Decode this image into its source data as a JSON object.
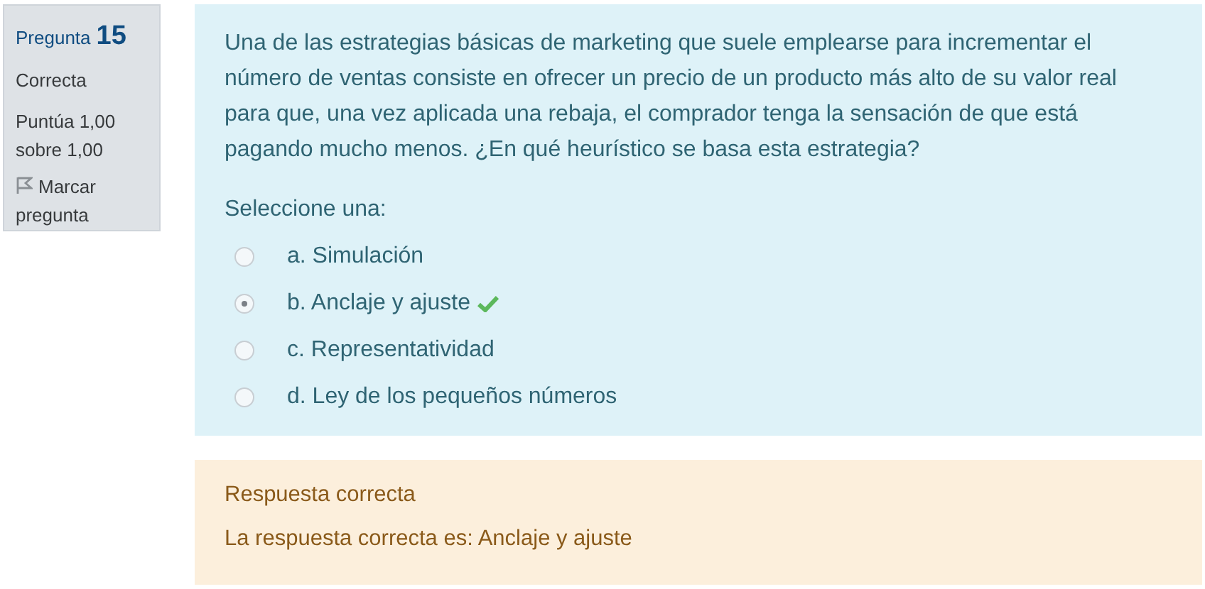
{
  "info": {
    "label": "Pregunta",
    "number": "15",
    "state": "Correcta",
    "grade": "Puntúa 1,00 sobre 1,00",
    "flag": {
      "label": "Marcar pregunta",
      "flagged": false
    }
  },
  "question": {
    "text": "Una de las estrategias básicas de marketing que suele emplearse para incrementar el número de ventas consiste en ofrecer un precio de un producto más alto de su valor real para que, una vez aplicada una rebaja, el comprador tenga la sensación de que está pagando mucho menos. ¿En qué heurístico se basa esta estrategia?",
    "prompt": "Seleccione una:",
    "options": [
      {
        "label": "a. Simulación",
        "selected": false,
        "correct": false
      },
      {
        "label": "b. Anclaje y ajuste",
        "selected": true,
        "correct": true
      },
      {
        "label": "c. Representatividad",
        "selected": false,
        "correct": false
      },
      {
        "label": "d. Ley de los pequeños números",
        "selected": false,
        "correct": false
      }
    ]
  },
  "feedback": {
    "status": "Respuesta correcta",
    "answer": "La respuesta correcta es: Anclaje y ajuste"
  }
}
